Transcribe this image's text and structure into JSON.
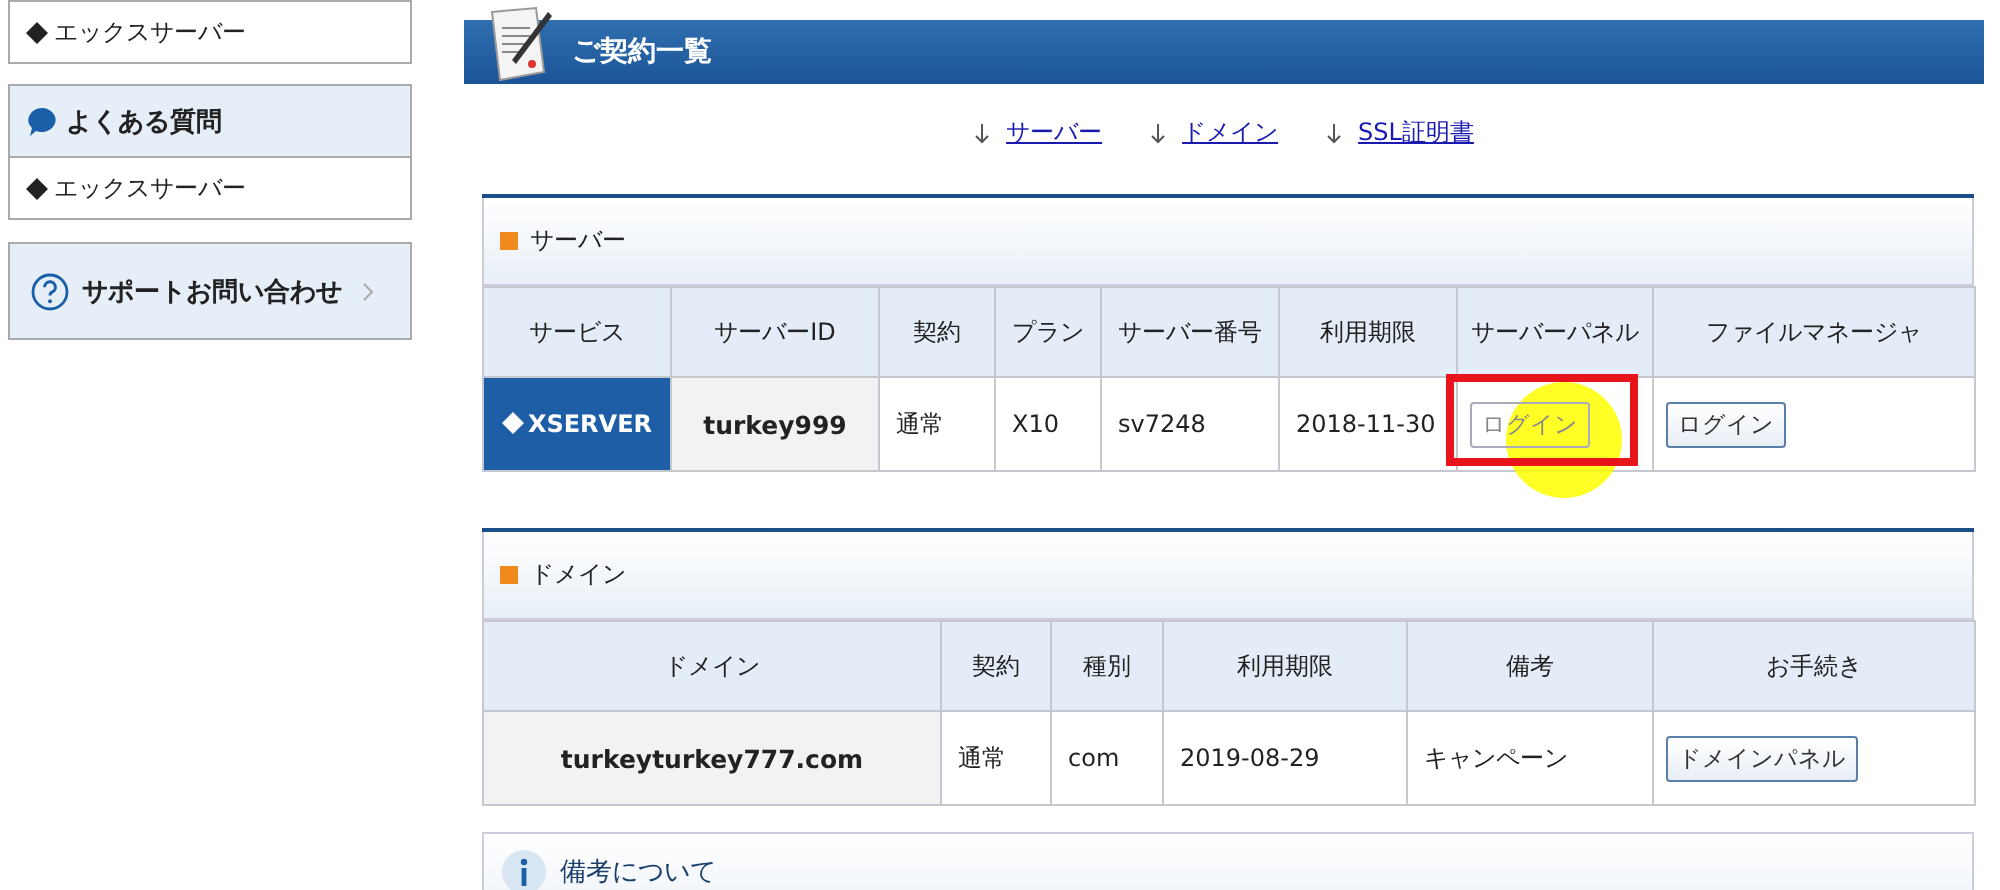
{
  "sidebar": {
    "blocks": [
      {
        "kind": "list",
        "items": [
          "エックスサーバー"
        ]
      },
      {
        "kind": "faq",
        "title": "よくある質問",
        "items": [
          "エックスサーバー"
        ]
      },
      {
        "kind": "support",
        "title": "サポートお問い合わせ"
      }
    ]
  },
  "page_title": "ご契約一覧",
  "anchors": [
    "サーバー",
    "ドメイン",
    "SSL証明書"
  ],
  "sections": [
    {
      "title": "サーバー",
      "columns": [
        "サービス",
        "サーバーID",
        "契約",
        "プラン",
        "サーバー番号",
        "利用期限",
        "サーバーパネル",
        "ファイルマネージャ"
      ],
      "rows": [
        [
          {
            "kind": "logo",
            "text": "XSERVER"
          },
          {
            "kind": "bold",
            "text": "turkey999"
          },
          {
            "kind": "text",
            "text": "通常"
          },
          {
            "kind": "text",
            "text": "X10"
          },
          {
            "kind": "text",
            "text": "sv7248"
          },
          {
            "kind": "text",
            "text": "2018-11-30"
          },
          {
            "kind": "button",
            "text": "ログイン",
            "highlighted": true
          },
          {
            "kind": "button",
            "text": "ログイン",
            "highlighted": false
          }
        ]
      ]
    },
    {
      "title": "ドメイン",
      "columns": [
        "ドメイン",
        "契約",
        "種別",
        "利用期限",
        "備考",
        "お手続き"
      ],
      "rows": [
        [
          {
            "kind": "bold",
            "text": "turkeyturkey777.com"
          },
          {
            "kind": "text",
            "text": "通常"
          },
          {
            "kind": "text",
            "text": "com"
          },
          {
            "kind": "text",
            "text": "2019-08-29"
          },
          {
            "kind": "text",
            "text": "キャンペーン"
          },
          {
            "kind": "button",
            "text": "ドメインパネル",
            "highlighted": false
          }
        ]
      ]
    }
  ],
  "notes": {
    "title": "備考について"
  }
}
